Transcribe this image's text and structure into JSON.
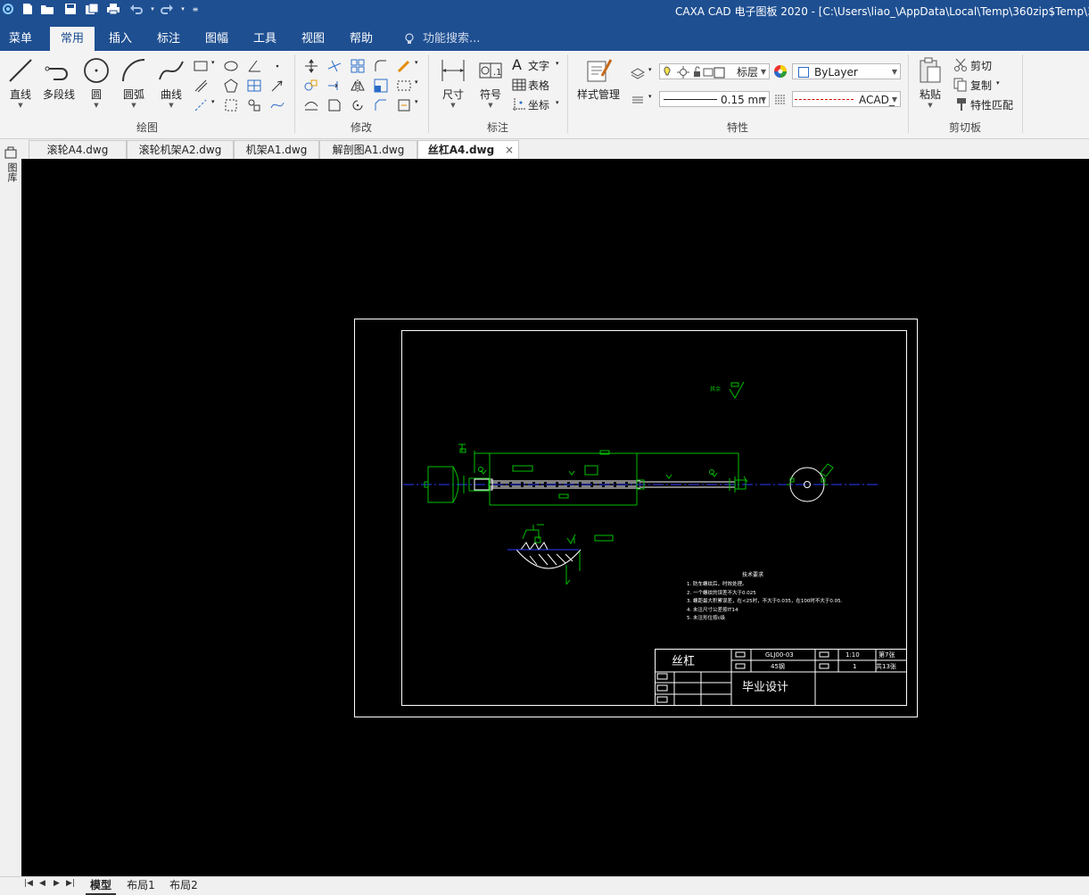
{
  "app": {
    "title": "CAXA CAD 电子图板 2020 - [C:\\Users\\liao_\\AppData\\Local\\Temp\\360zip$Temp\\360$5\\"
  },
  "quick_access": [
    "new-file-icon",
    "open-folder-icon",
    "save-icon",
    "save-all-icon",
    "print-icon",
    "undo-icon",
    "redo-icon",
    "customize-icon"
  ],
  "menu": {
    "items": [
      "菜单",
      "常用",
      "插入",
      "标注",
      "图幅",
      "工具",
      "视图",
      "帮助"
    ],
    "active": "常用",
    "search_placeholder": "功能搜索..."
  },
  "ribbon": {
    "draw": {
      "label": "绘图",
      "line": "直线",
      "polyline": "多段线",
      "circle": "圆",
      "arc": "圆弧",
      "curve": "曲线"
    },
    "modify": {
      "label": "修改"
    },
    "annotate": {
      "label": "标注",
      "dimension": "尺寸",
      "symbol": "符号",
      "text": "文字",
      "table": "表格",
      "coordinate": "坐标"
    },
    "properties": {
      "label": "特性",
      "style_manager": "样式管理",
      "layer": "标层",
      "color": "ByLayer",
      "lineweight": "0.15 mn",
      "linetype": "ACAD_"
    },
    "clipboard": {
      "label": "剪切板",
      "paste": "粘贴",
      "cut": "剪切",
      "copy": "复制",
      "match": "特性匹配"
    }
  },
  "left_panel": {
    "label": "图库"
  },
  "doc_tabs": [
    {
      "label": "滚轮A4.dwg"
    },
    {
      "label": "滚轮机架A2.dwg"
    },
    {
      "label": "机架A1.dwg"
    },
    {
      "label": "解剖图A1.dwg"
    },
    {
      "label": "丝杠A4.dwg",
      "active": true
    }
  ],
  "drawing": {
    "roughness_note": "其余",
    "tech_title": "技术要求",
    "tech_notes": [
      "1. 防车螺纹后，时效处理。",
      "2. 一个螺纹的误差不大于0.025",
      "3. 螺距最大积累误差，在<25时，不大于0.035，在100时不大于0.05.",
      "4. 未注尺寸公差按IT14",
      "5. 未注形位按c级"
    ],
    "title_block": {
      "part_name": "丝杠",
      "drawing_no": "GLJ00-03",
      "material": "45钢",
      "scale": "1:10",
      "quantity": "1",
      "sheet": "第7张",
      "total": "共13张",
      "project": "毕业设计"
    }
  },
  "layout_tabs": [
    {
      "label": "模型",
      "active": true
    },
    {
      "label": "布局1"
    },
    {
      "label": "布局2"
    }
  ],
  "colors": {
    "title_bar": "#1e4f91",
    "ribbon_bg": "#f3f3f3",
    "canvas_bg": "#000000",
    "cad_green": "#00c000",
    "cad_white": "#ffffff",
    "cad_blue": "#2a3cff",
    "cad_yellow": "#d8d800"
  }
}
